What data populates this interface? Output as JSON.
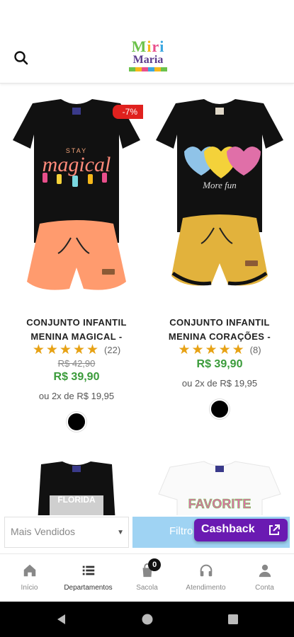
{
  "header": {
    "logo_line1": "Miri",
    "logo_line2": "Maria",
    "logo_colors": [
      "#6cc24a",
      "#f6b81a",
      "#e94f8b",
      "#3ba7e0",
      "#5b3a8c"
    ]
  },
  "products": [
    {
      "name_line1": "CONJUNTO INFANTIL",
      "name_line2": "MENINA MAGICAL -",
      "discount": "-7%",
      "rating_stars": 5,
      "rating_count": "(22)",
      "old_price": "R$ 42,90",
      "price": "R$ 39,90",
      "installments": "ou 2x de R$ 19,95",
      "shirt_text_1": "STAY",
      "shirt_text_2": "magical",
      "shorts_color": "#ff9b6e",
      "swatch_color": "#000000"
    },
    {
      "name_line1": "CONJUNTO INFANTIL",
      "name_line2": "MENINA CORAÇÕES -",
      "rating_stars": 5,
      "rating_count": "(8)",
      "price": "R$ 39,90",
      "installments": "ou 2x de R$ 19,95",
      "shirt_text_1": "More fun",
      "shorts_color": "#e2b23c",
      "swatch_color": "#000000"
    },
    {
      "shirt_text": "FLORIDA"
    },
    {
      "shirt_text": "FAVORITE"
    }
  ],
  "filter_bar": {
    "sort_label": "Mais Vendidos",
    "filter_label": "Filtro",
    "cashback_label": "Cashback"
  },
  "bottom_nav": {
    "items": [
      {
        "label": "Início",
        "icon": "home-icon"
      },
      {
        "label": "Departamentos",
        "icon": "list-icon"
      },
      {
        "label": "Sacola",
        "icon": "bag-icon",
        "badge": "0"
      },
      {
        "label": "Atendimento",
        "icon": "headset-icon"
      },
      {
        "label": "Conta",
        "icon": "person-icon"
      }
    ],
    "active_index": 1
  },
  "colors": {
    "price_green": "#3a9b3a",
    "star": "#e7a215",
    "discount_red": "#e0211e",
    "filter_blue": "#9fd3f3",
    "cashback_purple": "#6a1ab2"
  }
}
